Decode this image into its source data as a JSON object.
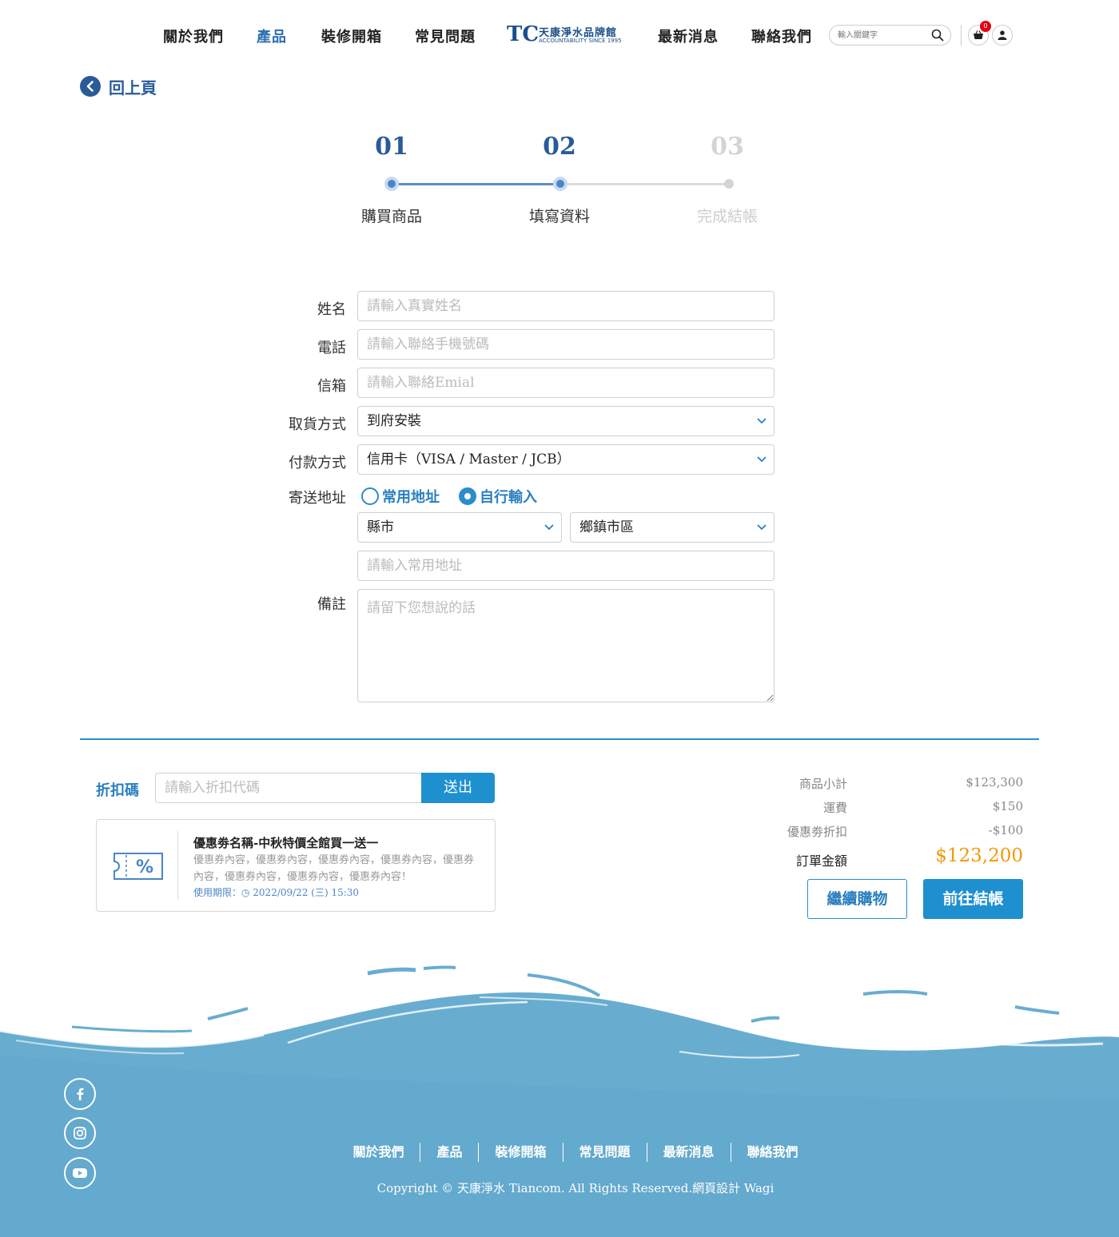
{
  "header": {
    "nav": [
      "關於我們",
      "產品",
      "裝修開箱",
      "常見問題",
      "最新消息",
      "聯絡我們"
    ],
    "logo_mark": "TC",
    "logo_title": "天康淨水品牌館",
    "logo_sub": "ACCOUNTABILITY SINCE 1995",
    "search_placeholder": "輸入關鍵字",
    "cart_count": "0"
  },
  "back": {
    "label": "回上頁"
  },
  "steps": [
    {
      "num": "01",
      "label": "購買商品",
      "state": "done"
    },
    {
      "num": "02",
      "label": "填寫資料",
      "state": "active"
    },
    {
      "num": "03",
      "label": "完成結帳",
      "state": "inactive"
    }
  ],
  "form": {
    "name_label": "姓名",
    "name_placeholder": "請輸入真實姓名",
    "phone_label": "電話",
    "phone_placeholder": "請輸入聯絡手機號碼",
    "email_label": "信箱",
    "email_placeholder": "請輸入聯絡Emial",
    "pickup_label": "取貨方式",
    "pickup_value": "到府安裝",
    "payment_label": "付款方式",
    "payment_value": "信用卡（VISA / Master / JCB）",
    "address_label": "寄送地址",
    "radio_common": "常用地址",
    "radio_manual": "自行輸入",
    "county_value": "縣市",
    "district_value": "鄉鎮市區",
    "address_placeholder": "請輸入常用地址",
    "note_label": "備註",
    "note_placeholder": "請留下您想說的話"
  },
  "discount": {
    "label": "折扣碼",
    "placeholder": "請輸入折扣代碼",
    "submit": "送出"
  },
  "coupon": {
    "title": "優惠劵名稱-中秋特價全館買一送一",
    "desc": "優惠券內容，優惠券內容，優惠券內容，優惠券內容，優惠券內容，優惠券內容，優惠券內容，優惠券內容！",
    "expiry": "使用期限：◷ 2022/09/22 (三) 15:30"
  },
  "summary": {
    "subtotal_label": "商品小計",
    "subtotal": "$123,300",
    "shipping_label": "運費",
    "shipping": "$150",
    "coupon_label": "優惠劵折扣",
    "coupon_discount": "-$100",
    "total_label": "訂單金額",
    "total": "$123,200",
    "continue_label": "繼續購物",
    "checkout_label": "前往結帳"
  },
  "footer": {
    "nav": [
      "關於我們",
      "產品",
      "裝修開箱",
      "常見問題",
      "最新消息",
      "聯絡我們"
    ],
    "copyright": "Copyright © 天康淨水 Tiancom. All Rights Reserved.網頁設計 Wagi"
  },
  "colors": {
    "primary": "#1e90d0",
    "navy": "#2a5a9a",
    "total": "#f39800",
    "water": "#68add0"
  }
}
